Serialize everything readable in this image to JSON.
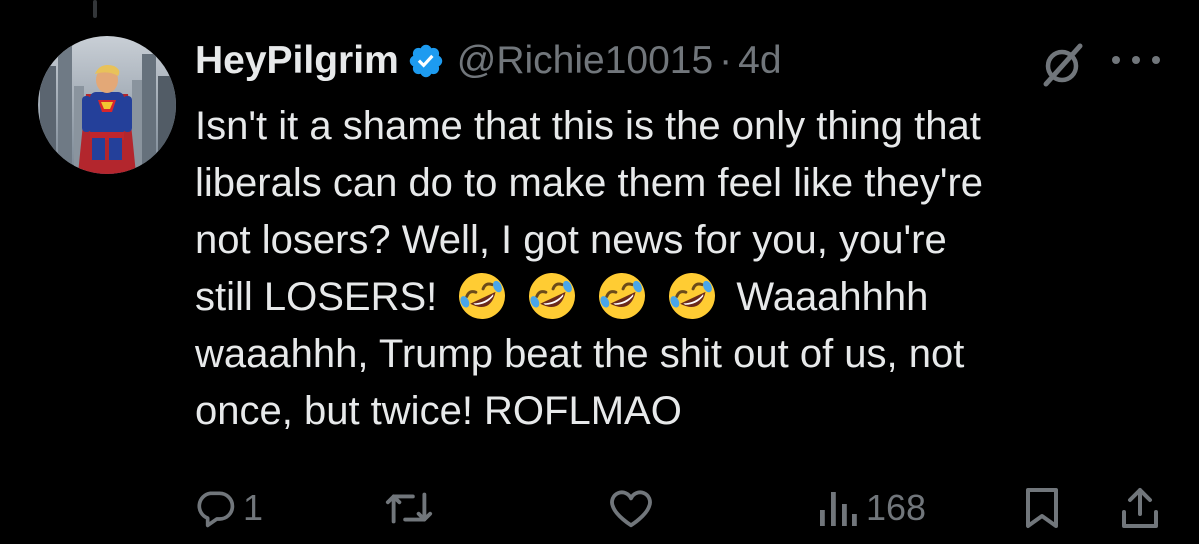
{
  "author": {
    "display_name": "HeyPilgrim",
    "handle": "@Richie10015",
    "separator": "·",
    "time": "4d"
  },
  "tweet": {
    "lines": [
      "Isn't it a shame that this is the only thing that",
      "liberals can do to make them feel like they're",
      "not losers? Well, I got news for you, you're"
    ],
    "line4_start": "still LOSERS!",
    "line4_end": "Waaahhhh",
    "lines_after": [
      "waaahhh, Trump beat the shit out of us, not",
      "once, but twice! ROFLMAO"
    ],
    "emojis": [
      "rolling-on-floor-laughing-emoji",
      "rolling-on-floor-laughing-emoji",
      "rolling-on-floor-laughing-emoji",
      "rolling-on-floor-laughing-emoji"
    ]
  },
  "actions": {
    "reply_count": "1",
    "retweet_count": "",
    "like_count": "",
    "views_count": "168"
  },
  "colors": {
    "background": "#000000",
    "text": "#e7e9ea",
    "secondary": "#71767b",
    "verified": "#1d9bf0",
    "emoji": "#ffcc33"
  }
}
